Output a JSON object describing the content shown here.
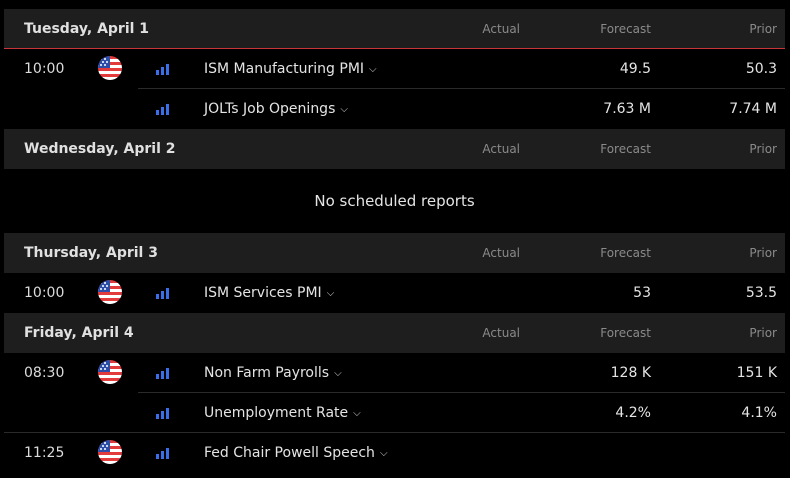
{
  "columns": {
    "actual": "Actual",
    "forecast": "Forecast",
    "prior": "Prior"
  },
  "days": [
    {
      "title": "Tuesday, April 1",
      "events": [
        {
          "time": "10:00",
          "name": "ISM Manufacturing PMI",
          "actual": "",
          "forecast": "49.5",
          "prior": "50.3",
          "flag": "us-flag-icon"
        },
        {
          "time": "",
          "name": "JOLTs Job Openings",
          "actual": "",
          "forecast": "7.63 M",
          "prior": "7.74 M",
          "flag": ""
        }
      ]
    },
    {
      "title": "Wednesday, April 2",
      "empty_text": "No scheduled reports",
      "events": []
    },
    {
      "title": "Thursday, April 3",
      "events": [
        {
          "time": "10:00",
          "name": "ISM Services PMI",
          "actual": "",
          "forecast": "53",
          "prior": "53.5",
          "flag": "us-flag-icon"
        }
      ]
    },
    {
      "title": "Friday, April 4",
      "events": [
        {
          "time": "08:30",
          "name": "Non Farm Payrolls",
          "actual": "",
          "forecast": "128 K",
          "prior": "151 K",
          "flag": "us-flag-icon"
        },
        {
          "time": "",
          "name": "Unemployment Rate",
          "actual": "",
          "forecast": "4.2%",
          "prior": "4.1%",
          "flag": ""
        },
        {
          "time": "11:25",
          "name": "Fed Chair Powell Speech",
          "actual": "",
          "forecast": "",
          "prior": "",
          "flag": "us-flag-icon"
        }
      ]
    }
  ],
  "colors": {
    "accent_line": "#c9343a",
    "importance_bars": "#3a6fe8",
    "header_bg": "#1e1e1e"
  },
  "icons": {
    "importance": "importance-bars-icon",
    "expand": "chevron-down-icon"
  }
}
